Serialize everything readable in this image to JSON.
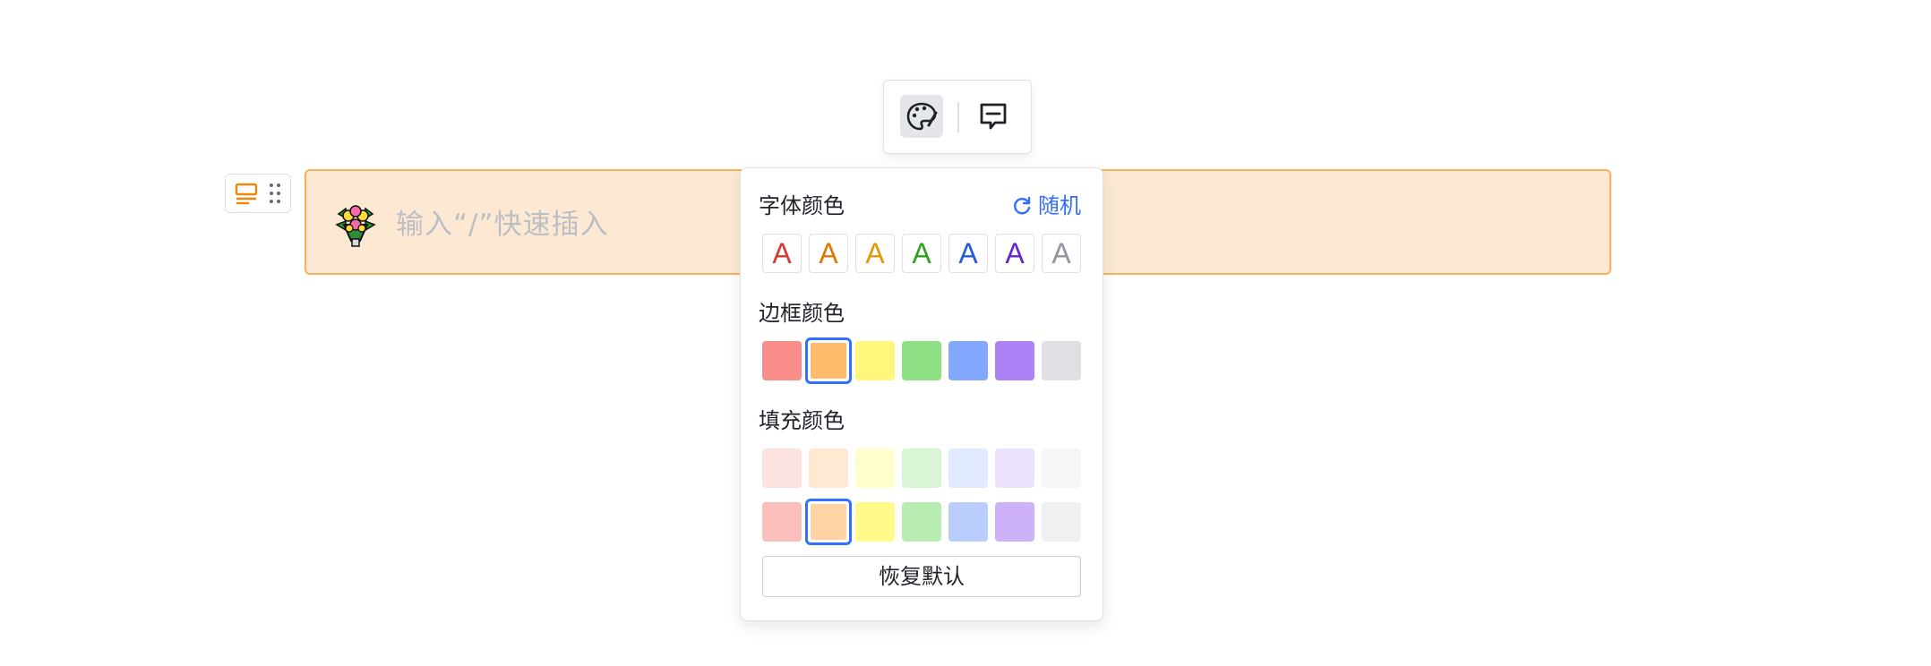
{
  "callout": {
    "placeholder": "输入“/”快速插入",
    "emoji_icon": "bouquet-icon",
    "background": "#fde9d3",
    "border": "#fbb255"
  },
  "block_handle": {
    "icons": [
      "callout-block-icon",
      "drag-handle-icon"
    ]
  },
  "toolbar": {
    "buttons": [
      {
        "icon": "palette-icon",
        "active": true
      },
      {
        "icon": "comment-icon",
        "active": false
      }
    ]
  },
  "color_panel": {
    "font_color_title": "字体颜色",
    "random_label": "随机",
    "border_color_title": "边框颜色",
    "fill_color_title": "填充颜色",
    "reset_label": "恢复默认",
    "font_letter": "A",
    "font_colors": [
      "#d83931",
      "#de7802",
      "#dc9b04",
      "#2ea121",
      "#245bdb",
      "#6425d0",
      "#8f959e"
    ],
    "border_colors": [
      "#f98e8b",
      "#ffba6b",
      "#fff67a",
      "#8ee085",
      "#82a7fc",
      "#ad82f7",
      "#dee0e3"
    ],
    "border_selected_index": 1,
    "fill_colors_light": [
      "#fde2e2",
      "#feead2",
      "#ffffcc",
      "#d9f5d6",
      "#e1eaff",
      "#ece2fe",
      "#f5f6f7"
    ],
    "fill_colors_medium": [
      "#fbbfbc",
      "#fed4a4",
      "#fffb8b",
      "#b7edb1",
      "#bacefd",
      "#cdb2fa",
      "#eff0f1"
    ],
    "fill_selected_row": 1,
    "fill_selected_index": 1,
    "accent": "#3370ff"
  }
}
